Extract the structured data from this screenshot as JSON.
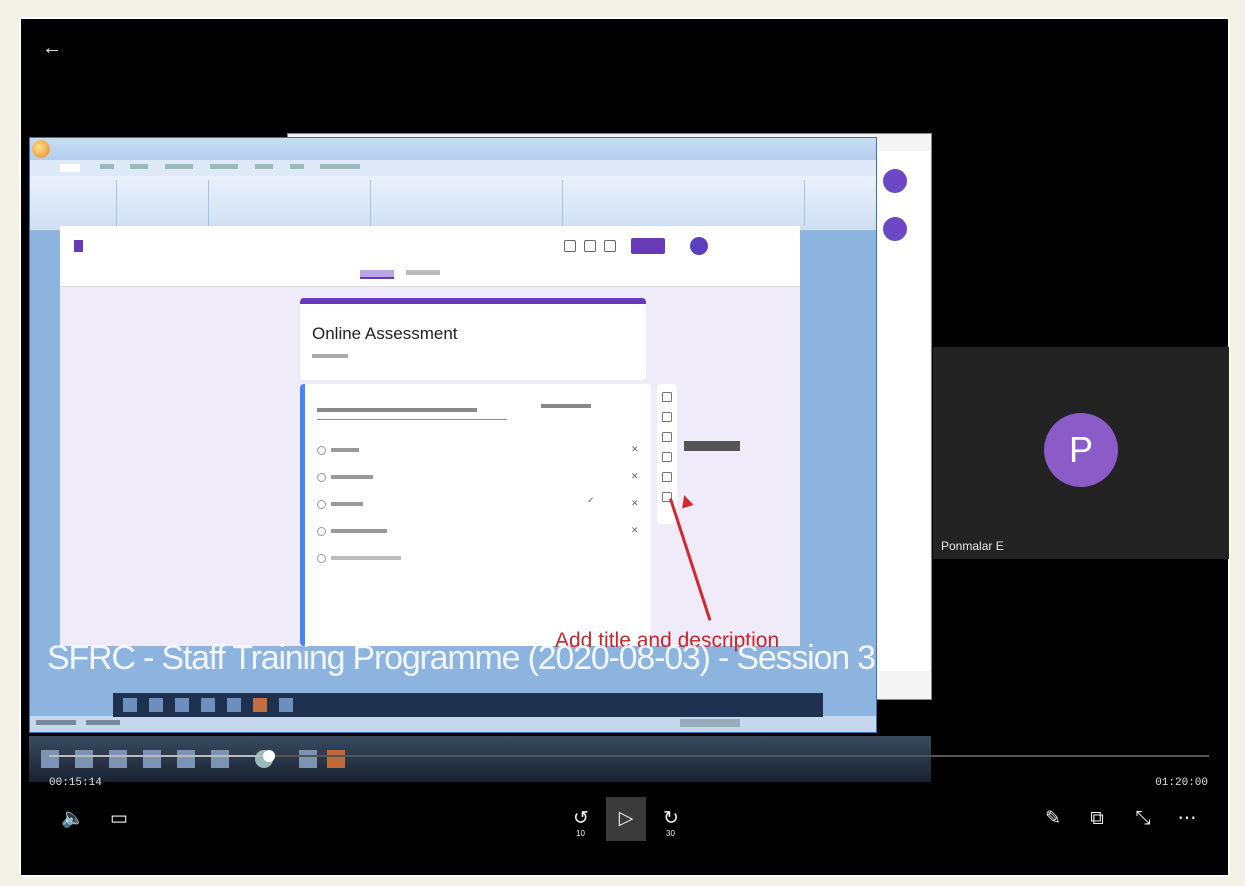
{
  "player": {
    "current_time": "00:15:14",
    "duration": "01:20:00",
    "progress_fraction": 0.19
  },
  "participant": {
    "initial": "P",
    "name": "Ponmalar E"
  },
  "shared_screen": {
    "subtitle": "SFRC - Staff Training Programme (2020-08-03) - Session 3",
    "annotation": "Add title and description",
    "form_title": "Online Assessment"
  },
  "controls": {
    "skip_back_seconds": "10",
    "skip_forward_seconds": "30"
  },
  "icons": {
    "back": "arrow-left-icon",
    "volume": "volume-icon",
    "captions": "captions-icon",
    "rewind": "rewind-10-icon",
    "play": "play-icon",
    "forward": "forward-30-icon",
    "pen": "pen-icon",
    "miniplayer": "miniplayer-icon",
    "exit_fullscreen": "exit-fullscreen-icon",
    "more": "more-options-icon"
  },
  "colors": {
    "participant_avatar": "#8b5bc8",
    "forms_accent": "#673ab7",
    "annotation": "#c4272b"
  }
}
